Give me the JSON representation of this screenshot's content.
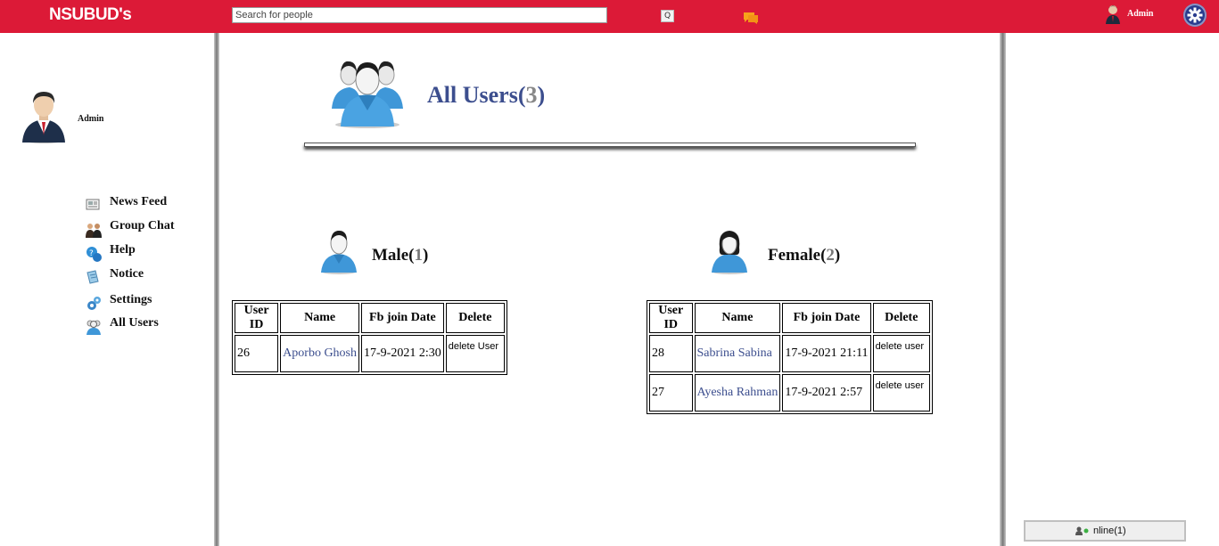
{
  "app": {
    "logo": "NSUBUD's"
  },
  "header": {
    "search_placeholder": "Search for people",
    "search_button": "Q",
    "username": "Admin"
  },
  "profile": {
    "name": "Admin"
  },
  "sidebar": {
    "items": [
      {
        "label": "News Feed",
        "icon": "newspaper-icon"
      },
      {
        "label": "Group Chat",
        "icon": "group-chat-icon"
      },
      {
        "label": "Help",
        "icon": "help-icon"
      },
      {
        "label": "Notice",
        "icon": "notice-icon"
      },
      {
        "label": "Settings",
        "icon": "settings-icon"
      },
      {
        "label": "All Users",
        "icon": "all-users-icon"
      }
    ]
  },
  "main": {
    "title": "All Users(",
    "title_count": "3",
    "title_end": ")",
    "male": {
      "title": "Male(",
      "count": "1",
      "end": ")"
    },
    "female": {
      "title": "Female(",
      "count": "2",
      "end": ")"
    },
    "table_headers": [
      "User ID",
      "Name",
      "Fb join Date",
      "Delete"
    ],
    "male_rows": [
      {
        "id": "26",
        "name": "Aporbo Ghosh",
        "date": "17-9-2021 2:30",
        "delete": "delete User"
      }
    ],
    "female_rows": [
      {
        "id": "28",
        "name": "Sabrina Sabina",
        "date": "17-9-2021 21:11",
        "delete": "delete user"
      },
      {
        "id": "27",
        "name": "Ayesha Rahman",
        "date": "17-9-2021 2:57",
        "delete": "delete user"
      }
    ]
  },
  "online": {
    "label": "nline(1)"
  },
  "colors": {
    "topbar": "#dc1a37",
    "title": "#3c4e8e",
    "link": "#3c4e8e"
  }
}
